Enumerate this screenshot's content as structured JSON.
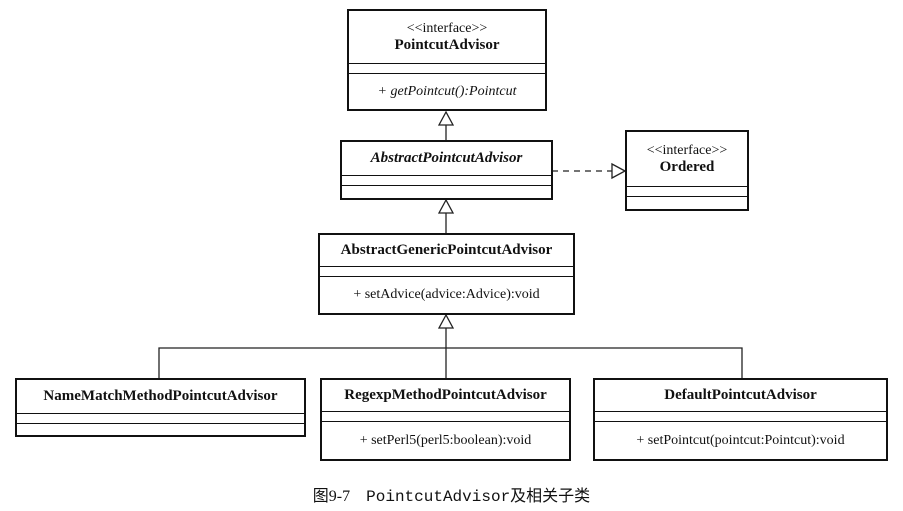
{
  "classes": {
    "pointcut_advisor": {
      "stereotype": "<<interface>>",
      "name": "PointcutAdvisor",
      "operation": "+ getPointcut():Pointcut"
    },
    "abstract_pointcut_advisor": {
      "name": "AbstractPointcutAdvisor"
    },
    "ordered": {
      "stereotype": "<<interface>>",
      "name": "Ordered"
    },
    "abstract_generic": {
      "name": "AbstractGenericPointcutAdvisor",
      "operation": "+ setAdvice(advice:Advice):void"
    },
    "name_match": {
      "name": "NameMatchMethodPointcutAdvisor"
    },
    "regexp": {
      "name": "RegexpMethodPointcutAdvisor",
      "operation": "+ setPerl5(perl5:boolean):void"
    },
    "default": {
      "name": "DefaultPointcutAdvisor",
      "operation": "+ setPointcut(pointcut:Pointcut):void"
    }
  },
  "caption": {
    "figure": "图9-7",
    "code": "PointcutAdvisor",
    "text": "及相关子类"
  }
}
